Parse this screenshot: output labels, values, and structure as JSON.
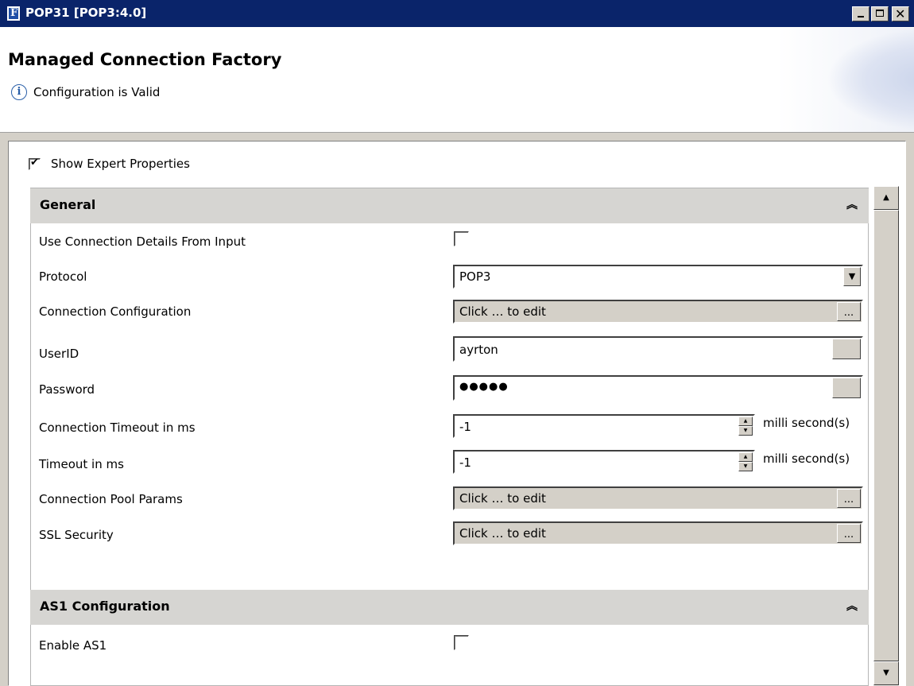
{
  "window": {
    "title": "POP31 [POP3:4.0]",
    "icon": "app-f-icon",
    "controls": [
      "minimize-icon",
      "maximize-icon",
      "close-icon"
    ]
  },
  "header": {
    "title": "Managed Connection Factory",
    "status": "Configuration is Valid",
    "status_icon": "info-icon"
  },
  "options": {
    "show_expert_label": "Show Expert Properties",
    "show_expert_checked": true
  },
  "sections": {
    "general": {
      "title": "General",
      "fields": {
        "use_conn_details": {
          "label": "Use Connection Details From Input",
          "checked": false
        },
        "protocol": {
          "label": "Protocol",
          "value": "POP3"
        },
        "conn_config": {
          "label": "Connection Configuration",
          "value": "Click … to edit",
          "button": "..."
        },
        "userid": {
          "label": "UserID",
          "value": "ayrton"
        },
        "password": {
          "label": "Password",
          "value": "●●●●●"
        },
        "conn_timeout": {
          "label": "Connection Timeout in ms",
          "value": "-1",
          "unit": "milli second(s)"
        },
        "timeout": {
          "label": "Timeout in ms",
          "value": "-1",
          "unit": "milli second(s)"
        },
        "pool_params": {
          "label": "Connection Pool Params",
          "value": "Click … to edit",
          "button": "..."
        },
        "ssl": {
          "label": "SSL Security",
          "value": "Click … to edit",
          "button": "..."
        }
      }
    },
    "as1": {
      "title": "AS1 Configuration",
      "fields": {
        "enable_as1": {
          "label": "Enable AS1",
          "checked": false
        }
      }
    }
  },
  "colors": {
    "titlebar": "#0a246a",
    "face": "#d4d0c8",
    "section_header": "#d6d5d2"
  }
}
